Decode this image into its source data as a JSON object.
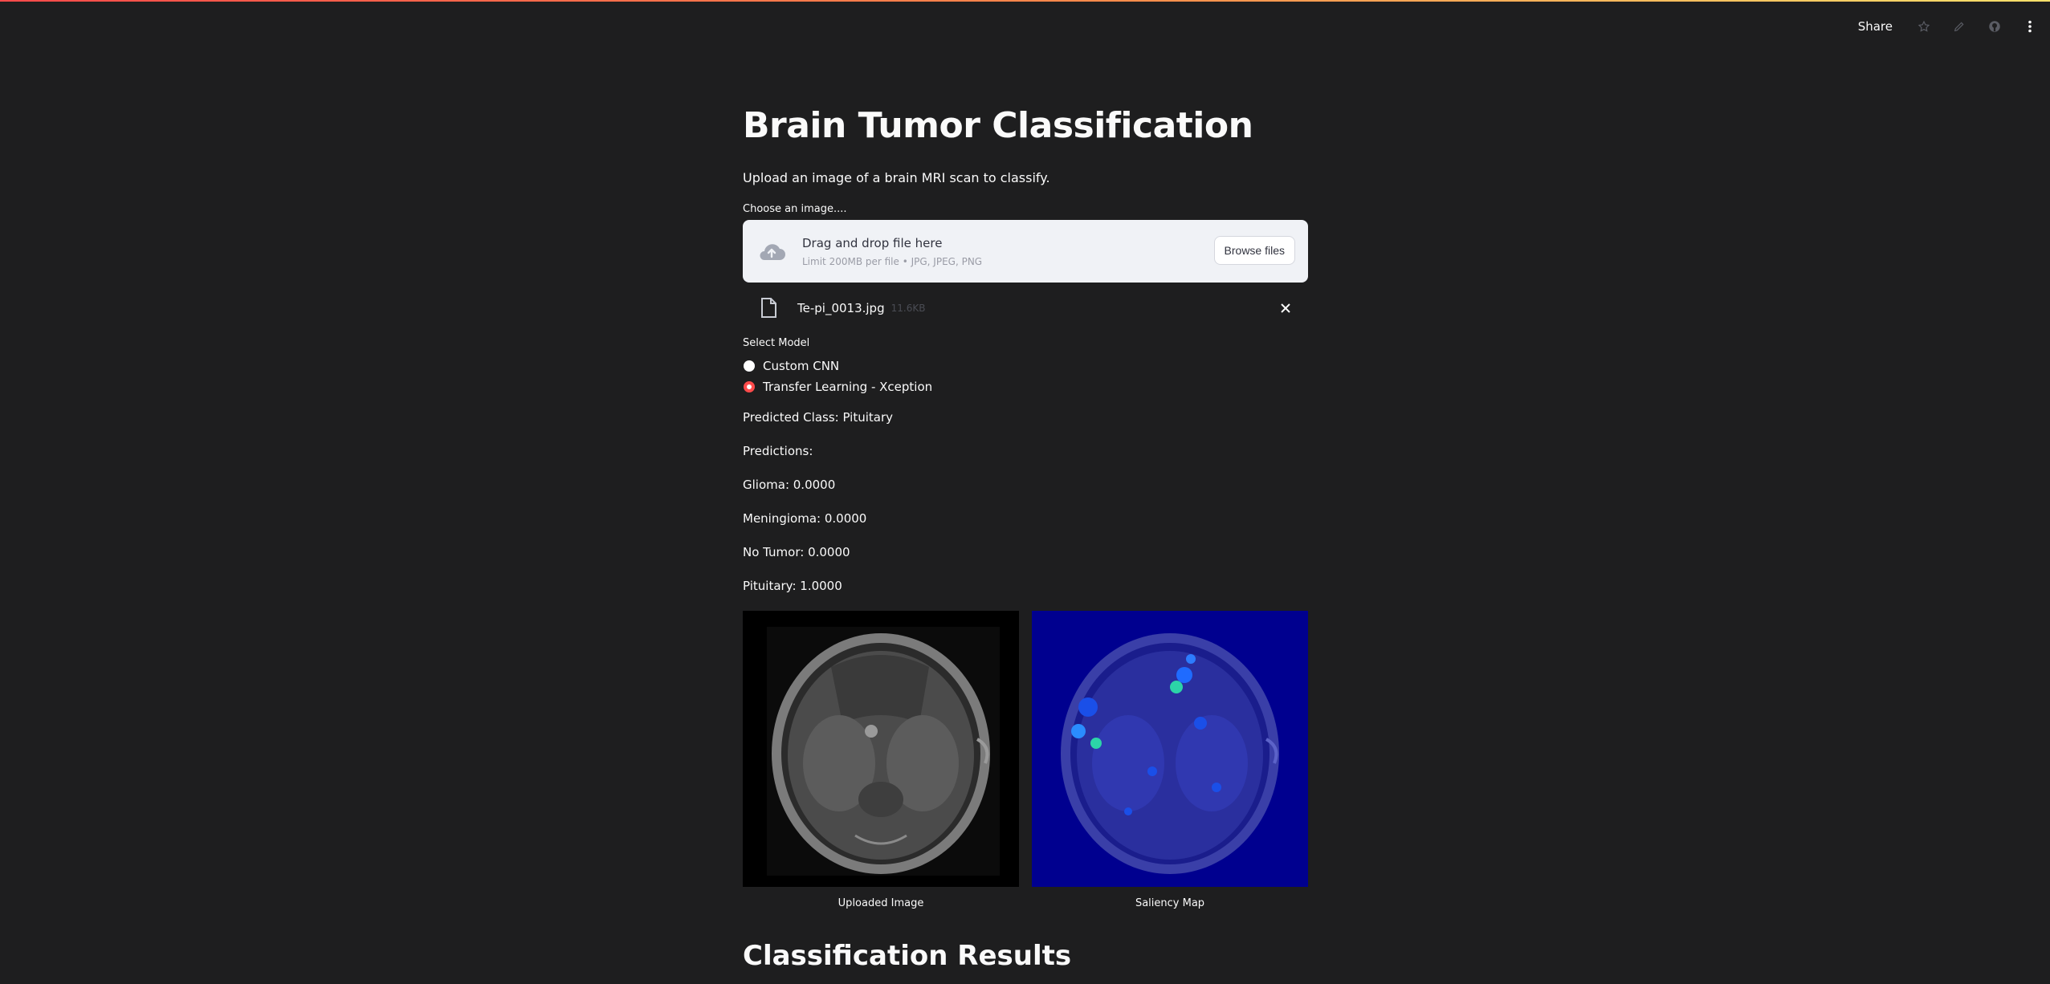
{
  "toolbar": {
    "share_label": "Share",
    "icons": [
      "star-icon",
      "edit-icon",
      "github-icon",
      "more-vertical-icon"
    ]
  },
  "page": {
    "title": "Brain Tumor Classification",
    "subtitle": "Upload an image of a brain MRI scan to classify."
  },
  "uploader": {
    "label": "Choose an image....",
    "drop_text": "Drag and drop file here",
    "limit_text": "Limit 200MB per file • JPG, JPEG, PNG",
    "browse_label": "Browse files",
    "file_name": "Te-pi_0013.jpg",
    "file_size": "11.6KB"
  },
  "model_select": {
    "label": "Select Model",
    "options": [
      "Custom CNN",
      "Transfer Learning - Xception"
    ],
    "selected": "Transfer Learning - Xception"
  },
  "results": {
    "predicted_class": "Predicted Class: Pituitary",
    "predictions_header": "Predictions:",
    "lines": [
      "Glioma: 0.0000",
      "Meningioma: 0.0000",
      "No Tumor: 0.0000",
      "Pituitary: 1.0000"
    ]
  },
  "images": {
    "uploaded_caption": "Uploaded Image",
    "saliency_caption": "Saliency Map"
  },
  "section_heading": "Classification Results",
  "colors": {
    "background": "#1e1e1f",
    "accent": "#ff4b4b",
    "dropzone": "#f0f2f6"
  }
}
